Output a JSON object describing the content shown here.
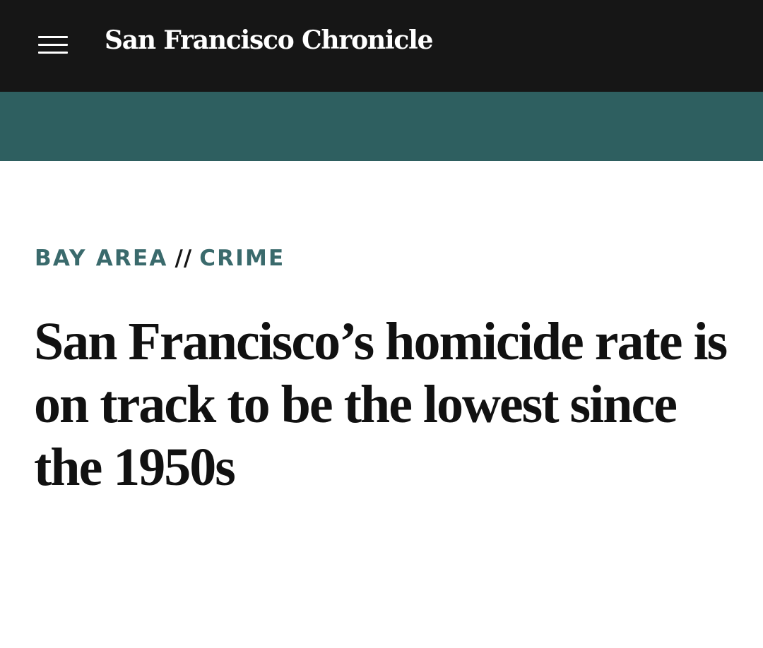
{
  "header": {
    "logo_text": "San Francisco Chronicle",
    "menu_icon": "hamburger-menu-icon",
    "background_color": "#161616"
  },
  "ad_band": {
    "background_color": "#2e5f60"
  },
  "article": {
    "section": "BAY AREA",
    "separator": "//",
    "subsection": "CRIME",
    "kicker_color": "#3a6a6c",
    "headline": "San Francisco’s homicide rate is on track to be the lowest since the 1950s"
  }
}
